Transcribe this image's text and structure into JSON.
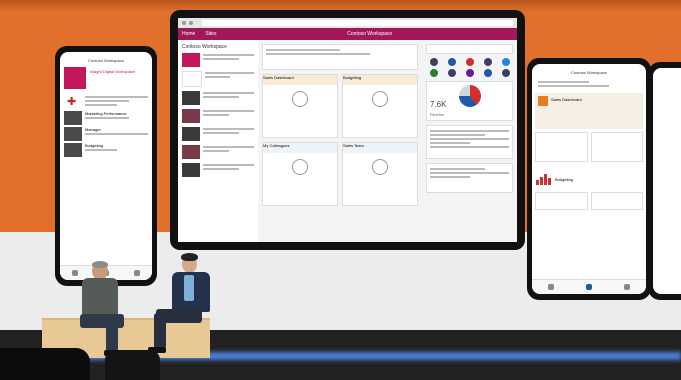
{
  "colors": {
    "wall": "#e0702a",
    "brand": "#a3185a",
    "stage": "#e8c995",
    "floor_light": "#4c7fd8"
  },
  "tablet": {
    "app_bar": {
      "left_items": [
        "Home",
        "Sites"
      ],
      "title": "Contoso Workspace"
    },
    "left_pane": {
      "heading": "Contoso Workspace"
    },
    "mid_pane": {
      "cards": [
        "Sales Dashboard",
        "Budgeting",
        "My Colleagues",
        "Sales Team"
      ]
    },
    "right_pane": {
      "stat_left": "7.6K",
      "stat_label": "Pipeline"
    }
  },
  "phone_left": {
    "title": "Contoso Workspace",
    "logo_text": "Insight Digital Workspace",
    "items": [
      "Marketing Performance",
      "Manager",
      "Budgeting"
    ]
  },
  "phone_right": {
    "title": "Contoso Workspace",
    "cards": [
      "Sales Dashboard",
      "Budgeting"
    ]
  },
  "icons": [
    "slack-icon",
    "pie-chart-icon",
    "bar-chart-icon"
  ]
}
